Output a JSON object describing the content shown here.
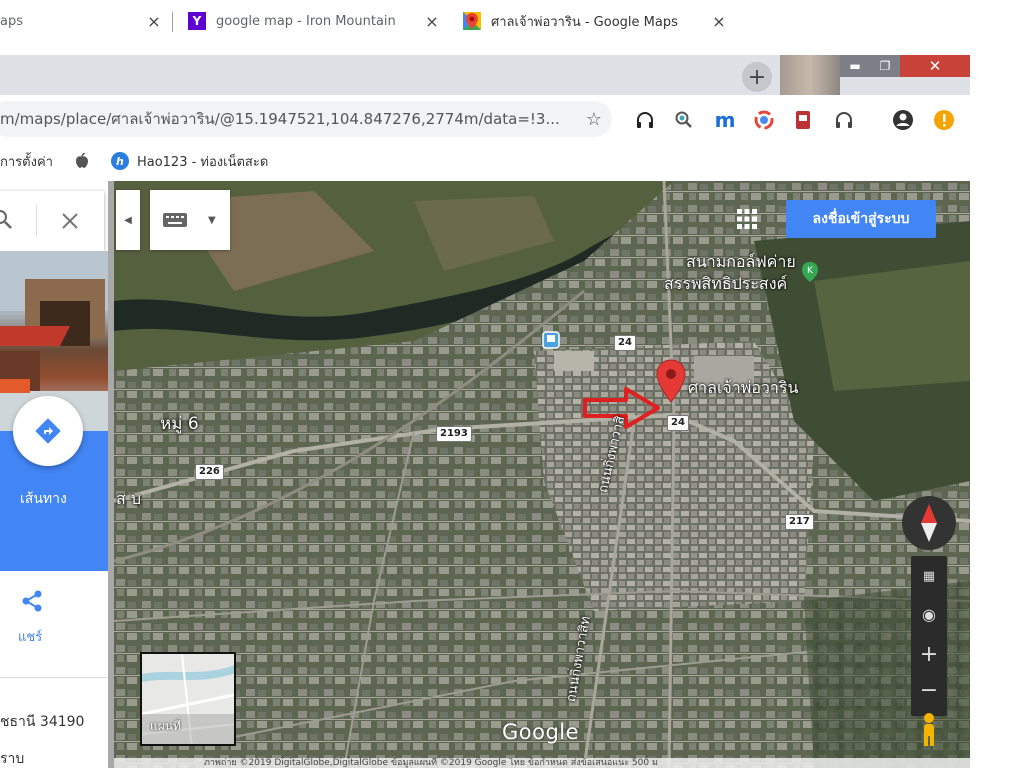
{
  "browser": {
    "tabs": [
      {
        "title": "aps",
        "close": "×"
      },
      {
        "title": "google map - Iron Mountain",
        "close": "×"
      },
      {
        "title": "ศาลเจ้าพ่อวาริน - Google Maps",
        "close": "×"
      }
    ],
    "new_tab": "+",
    "window": {
      "minimize": "▬",
      "maximize": "❐",
      "close": "✕"
    },
    "omnibox": {
      "url": "m/maps/place/ศาลเจ้าพ่อวาริน/@15.1947521,104.847276,2774m/data=!3...",
      "star": "☆"
    },
    "bookmarks": [
      {
        "label": "การตั้งค่า"
      },
      {
        "label": ""
      },
      {
        "label": "Hao123 - ท่องเน็ตสะด"
      }
    ]
  },
  "side_panel": {
    "directions_label": "เส้นทาง",
    "share_label": "แชร์",
    "address_line1": "ชธานี 34190",
    "address_line2": "ราบ"
  },
  "map": {
    "signin_button": "ลงชื่อเข้าสู่ระบบ",
    "place_label": "ศาลเจ้าพ่อวาริน",
    "golf_label_1": "สนามกอล์ฟค่าย",
    "golf_label_2": "สรรพสิทธิประสงค์",
    "village_label": "หมู่ 6",
    "area_label": "ส บ",
    "road_label_1": "ถนนกิ่งพาวาสิ",
    "road_label_2": "ถนนกิ่งพาวาสิท",
    "shields": [
      "24",
      "24",
      "2193",
      "226",
      "217"
    ],
    "thumbnail_label": "แผนที่",
    "google_logo": "Google",
    "footer": "ภาพถ่าย ©2019 DigitalGlobe,DigitalGlobe ข้อมูลแผนที่ ©2019 Google    ไทย    ข้อกำหนด    ส่งข้อเสนอแนะ    500 ม"
  },
  "colors": {
    "accent_blue": "#4285f4",
    "pin_red": "#e53935",
    "arrow_red": "#e02020"
  }
}
